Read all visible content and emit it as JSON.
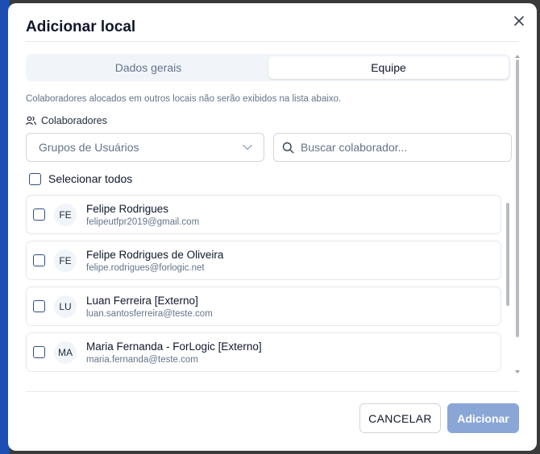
{
  "dialog": {
    "title": "Adicionar local"
  },
  "tabs": [
    {
      "label": "Dados gerais",
      "active": false
    },
    {
      "label": "Equipe",
      "active": true
    }
  ],
  "info_text": "Colaboradores alocados em outros locais não serão exibidos na lista abaixo.",
  "collaborators": {
    "section_label": "Colaboradores",
    "section_icon": "users-icon",
    "group_select": {
      "value": "Grupos de Usuários",
      "icon": "chevron-down-icon"
    },
    "search": {
      "placeholder": "Buscar colaborador...",
      "value": "",
      "icon": "search-icon"
    },
    "select_all_label": "Selecionar todos",
    "users": [
      {
        "initials": "FE",
        "name": "Felipe Rodrigues",
        "email": "felipeutfpr2019@gmail.com",
        "checked": false
      },
      {
        "initials": "FE",
        "name": "Felipe Rodrigues de Oliveira",
        "email": "felipe.rodrigues@forlogic.net",
        "checked": false
      },
      {
        "initials": "LU",
        "name": "Luan Ferreira [Externo]",
        "email": "luan.santosferreira@teste.com",
        "checked": false
      },
      {
        "initials": "MA",
        "name": "Maria Fernanda - ForLogic [Externo]",
        "email": "maria.fernanda@teste.com",
        "checked": false
      }
    ]
  },
  "footer": {
    "cancel_label": "CANCELAR",
    "add_label": "Adicionar"
  },
  "colors": {
    "primary_disabled": "#8aa6d6",
    "checkbox_border": "#2f4f7f",
    "text_muted": "#64748b"
  }
}
